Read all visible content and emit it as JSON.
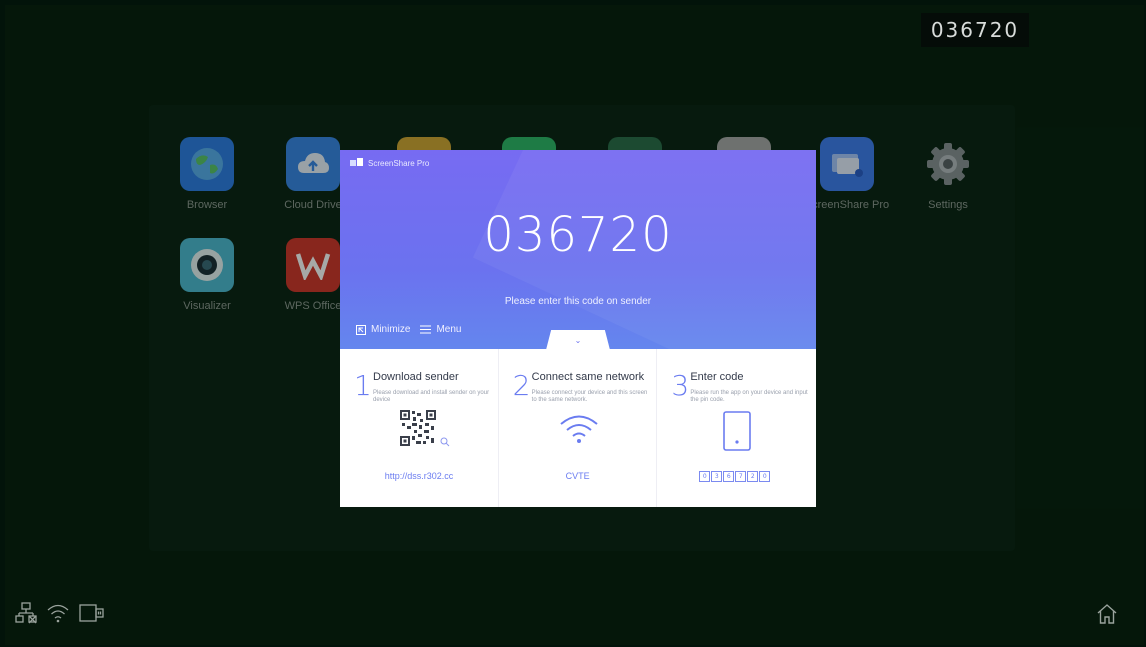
{
  "top_code": "036720",
  "apps": [
    {
      "label": "Browser",
      "icon": "globe-icon",
      "color": "#2f7fe6"
    },
    {
      "label": "Cloud Drive",
      "icon": "cloud-upload-icon",
      "color": "#3a88e8"
    },
    {
      "label": "",
      "icon": "app-icon",
      "color": "#d3a835"
    },
    {
      "label": "",
      "icon": "app-icon",
      "color": "#2fb869"
    },
    {
      "label": "",
      "icon": "app-icon",
      "color": "#2b6d4b"
    },
    {
      "label": "",
      "icon": "app-icon",
      "color": "#a9a9a9"
    },
    {
      "label": "ScreenShare Pro",
      "icon": "screenshare-icon",
      "color": "#3f7ef1"
    },
    {
      "label": "Settings",
      "icon": "gear-icon",
      "color": "#888f93"
    },
    {
      "label": "Visualizer",
      "icon": "camera-lens-icon",
      "color": "#4fbcd4"
    },
    {
      "label": "WPS Office",
      "icon": "wps-logo-icon",
      "color": "#d1362b"
    }
  ],
  "modal": {
    "app_title": "ScreenShare Pro",
    "code": "036720",
    "hint": "Please enter this code on sender",
    "minimize_label": "Minimize",
    "menu_label": "Menu",
    "accent": "#6b72ef",
    "steps": [
      {
        "num": "1",
        "title": "Download sender",
        "desc": "Please download and install sender on your device",
        "footer": "http://dss.r302.cc"
      },
      {
        "num": "2",
        "title": "Connect same network",
        "desc": "Please connect your device and this screen to the same network.",
        "footer": "CVTE"
      },
      {
        "num": "3",
        "title": "Enter code",
        "desc": "Please run the app on your device and input the pin code.",
        "pin": [
          "0",
          "3",
          "6",
          "7",
          "2",
          "0"
        ]
      }
    ]
  }
}
